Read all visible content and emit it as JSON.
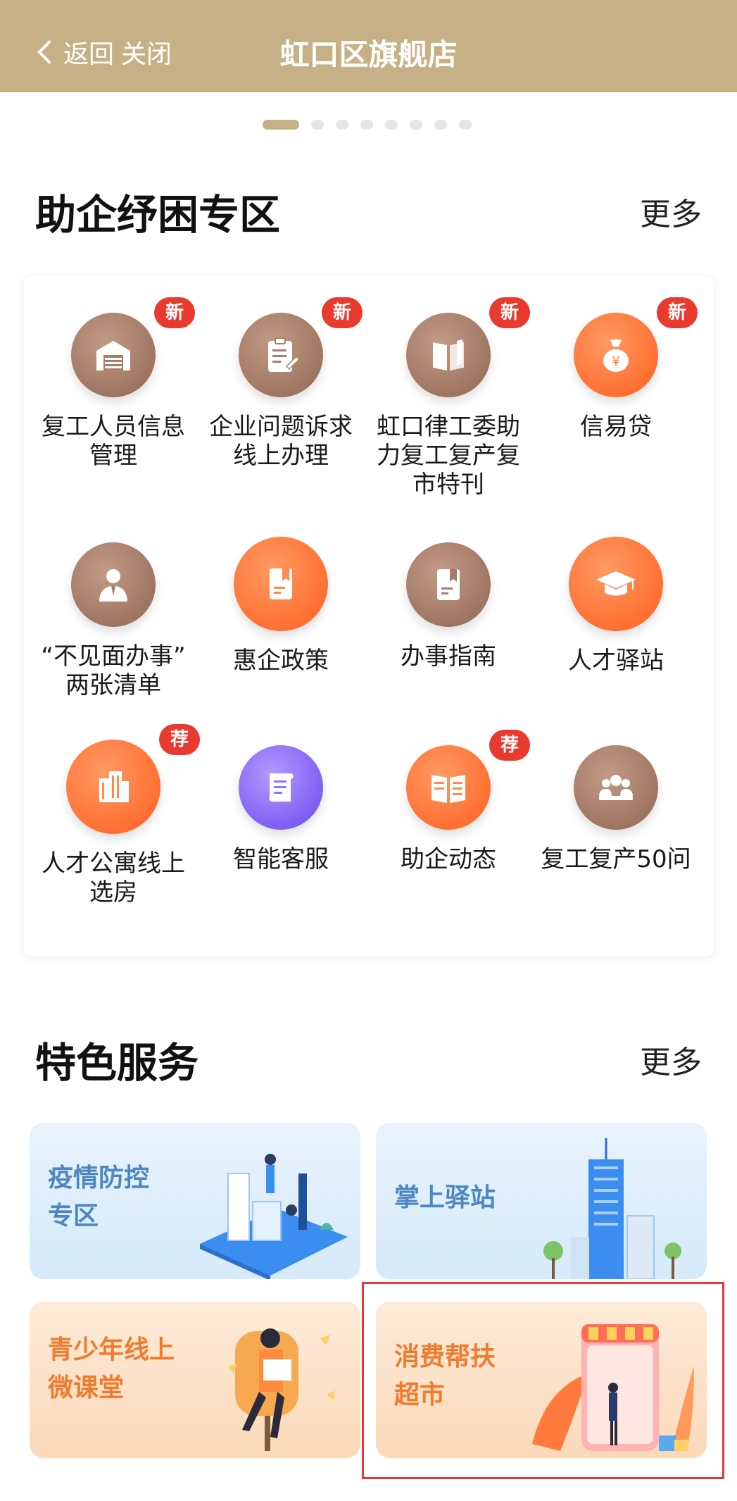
{
  "header": {
    "back_label": "返回",
    "close_label": "关闭",
    "title": "虹口区旗舰店"
  },
  "carousel": {
    "total": 8,
    "active_index": 0
  },
  "section1": {
    "title": "助企纾困专区",
    "more": "更多",
    "items": [
      {
        "label": "复工人员信息\n管理",
        "icon": "warehouse-icon",
        "color": "brown",
        "badge": "新"
      },
      {
        "label": "企业问题诉求\n线上办理",
        "icon": "clipboard-icon",
        "color": "brown",
        "badge": "新"
      },
      {
        "label": "虹口律工委助\n力复工复产复\n市特刊",
        "icon": "book-icon",
        "color": "brown",
        "badge": "新"
      },
      {
        "label": "信易贷",
        "icon": "money-bag-icon",
        "color": "orange",
        "badge": "新"
      },
      {
        "label": "“不见面办事”\n两张清单",
        "icon": "businessman-icon",
        "color": "brown",
        "badge": ""
      },
      {
        "label": "惠企政策",
        "icon": "policy-doc-icon",
        "color": "orange",
        "badge": ""
      },
      {
        "label": "办事指南",
        "icon": "guide-icon",
        "color": "brown",
        "badge": ""
      },
      {
        "label": "人才驿站",
        "icon": "graduation-cap-icon",
        "color": "orange",
        "badge": ""
      },
      {
        "label": "人才公寓线上\n选房",
        "icon": "apartment-icon",
        "color": "orange",
        "badge": "荐"
      },
      {
        "label": "智能客服",
        "icon": "scroll-icon",
        "color": "purple",
        "badge": ""
      },
      {
        "label": "助企动态",
        "icon": "newspaper-icon",
        "color": "orange",
        "badge": "荐"
      },
      {
        "label": "复工复产50问",
        "icon": "meeting-icon",
        "color": "brown",
        "badge": ""
      }
    ]
  },
  "section2": {
    "title": "特色服务",
    "more": "更多",
    "tiles": [
      {
        "label_line1": "疫情防控",
        "label_line2": "专区",
        "theme": "blue",
        "art": "office-people-illustration"
      },
      {
        "label_line1": "掌上驿站",
        "label_line2": "",
        "theme": "blue",
        "art": "tower-illustration"
      },
      {
        "label_line1": "青少年线上",
        "label_line2": "微课堂",
        "theme": "peach",
        "art": "reading-person-illustration"
      },
      {
        "label_line1": "消费帮扶",
        "label_line2": "超市",
        "theme": "peach",
        "art": "shop-illustration"
      }
    ]
  },
  "colors": {
    "brand": "#c6b186",
    "badge": "#e93a2f",
    "highlight": "#e53935"
  }
}
